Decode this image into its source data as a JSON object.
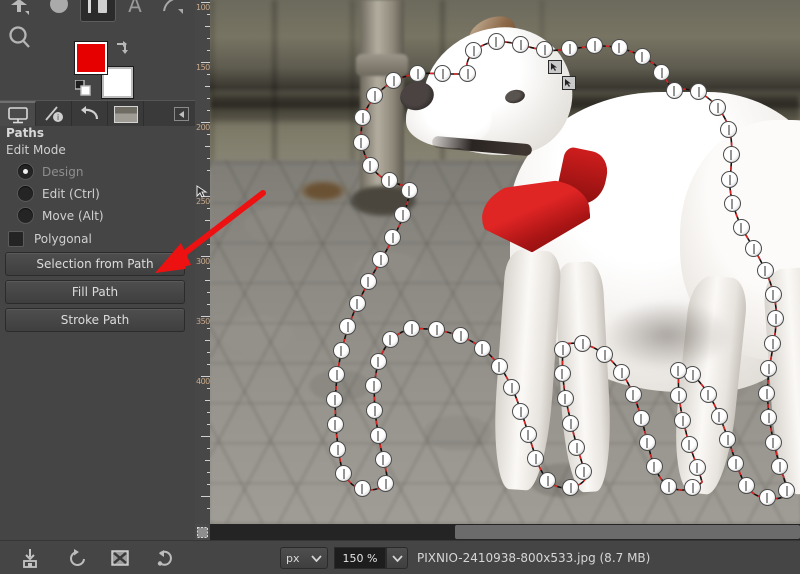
{
  "app": {
    "name": "GIMP",
    "accent_foreground_color": "#e60000",
    "accent_background_color": "#ffffff",
    "panel_bg_color": "#454545"
  },
  "toolbox": {
    "tools": [
      {
        "name": "unified-transform-tool",
        "icon": "transform-icon",
        "active": false
      },
      {
        "name": "blur-sharpen-tool",
        "icon": "blur-icon",
        "active": false
      },
      {
        "name": "measure-tool",
        "icon": "measure-icon",
        "active": true
      },
      {
        "name": "text-tool",
        "icon": "text-icon",
        "label": "A",
        "active": false
      },
      {
        "name": "paths-tool",
        "icon": "paths-icon",
        "active": false
      }
    ],
    "search_tool": "search-icon",
    "swap_colors": "swap-colors-icon",
    "default_colors": "default-colors-icon"
  },
  "dock_tabs": [
    {
      "name": "tool-options-tab",
      "icon": "tool-options-icon",
      "active": true
    },
    {
      "name": "pointer-tab",
      "icon": "pointer-info-icon",
      "active": false
    },
    {
      "name": "undo-history-tab",
      "icon": "undo-arrow-icon",
      "active": false
    },
    {
      "name": "images-tab",
      "icon": "image-thumbnail-icon",
      "active": false
    }
  ],
  "dock_menu_button": "dock-menu-icon",
  "tool_options": {
    "title": "Paths",
    "edit_mode_label": "Edit Mode",
    "modes": [
      {
        "label": "Design",
        "selected": true,
        "dim": true
      },
      {
        "label": "Edit (Ctrl)",
        "selected": false,
        "dim": false
      },
      {
        "label": "Move (Alt)",
        "selected": false,
        "dim": false
      }
    ],
    "polygonal": {
      "label": "Polygonal",
      "checked": false
    },
    "buttons": [
      {
        "label": "Selection from Path",
        "highlighted": true
      },
      {
        "label": "Fill Path",
        "highlighted": false
      },
      {
        "label": "Stroke Path",
        "highlighted": false
      }
    ]
  },
  "options_toolbar": [
    {
      "name": "save-tool-preset-button",
      "icon": "save-icon"
    },
    {
      "name": "restore-tool-preset-button",
      "icon": "restore-icon"
    },
    {
      "name": "delete-tool-preset-button",
      "icon": "delete-icon"
    },
    {
      "name": "reset-tool-options-button",
      "icon": "reset-icon"
    }
  ],
  "ruler": {
    "unit": "px",
    "vertical_labels": [
      "100",
      "150",
      "200",
      "250",
      "300",
      "350",
      "400"
    ]
  },
  "statusbar": {
    "unit_value": "px",
    "zoom_value": "150 %",
    "filename": "PIXNIO-2410938-800x533.jpg (8.7 MB)"
  },
  "canvas": {
    "subject": "white jack russell terrier dog with red collar on cobblestone street",
    "path_active": true,
    "annotation": {
      "type": "red-arrow",
      "points_to": "Selection from Path",
      "color": "#ee1111"
    }
  }
}
